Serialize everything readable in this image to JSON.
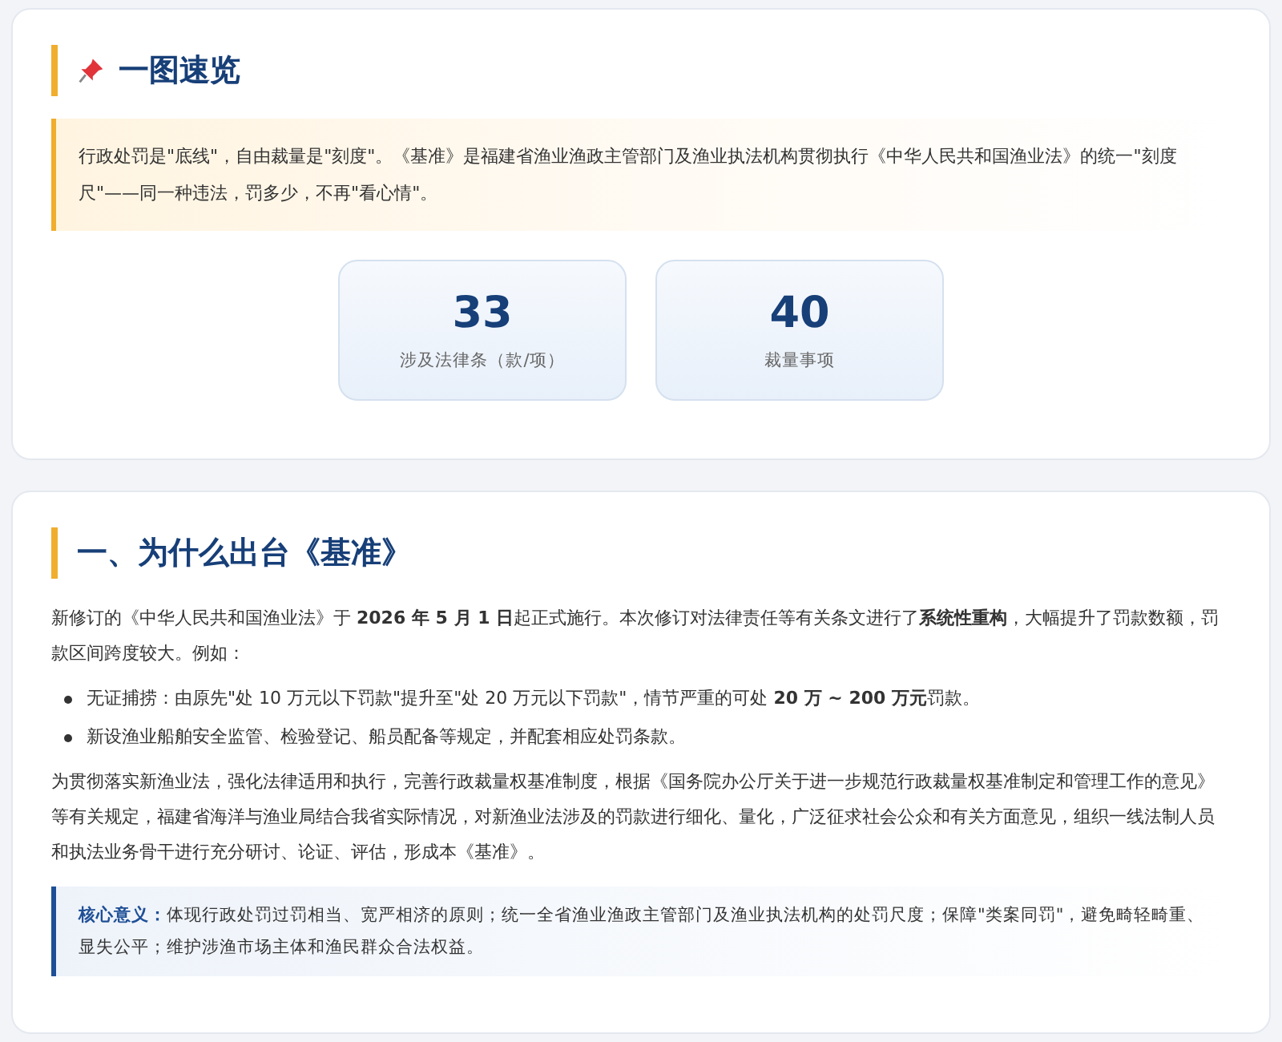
{
  "overview": {
    "title": "一图速览",
    "intro": "行政处罚是\"底线\"，自由裁量是\"刻度\"。《基准》是福建省渔业渔政主管部门及渔业执法机构贯彻执行《中华人民共和国渔业法》的统一\"刻度尺\"——同一种违法，罚多少，不再\"看心情\"。",
    "stats": [
      {
        "value": "33",
        "label": "涉及法律条（款/项）"
      },
      {
        "value": "40",
        "label": "裁量事项"
      }
    ]
  },
  "why": {
    "title": "一、为什么出台《基准》",
    "paragraph_1": "新修订的《中华人民共和国渔业法》于 **2026 年 5 月 1 日**起正式施行。本次修订对法律责任等有关条文进行了**系统性重构**，大幅提升了罚款数额，罚款区间跨度较大。例如：",
    "bullets": [
      "无证捕捞：由原先\"处 10 万元以下罚款\"提升至\"处 20 万元以下罚款\"，情节严重的可处 **20 万 ~ 200 万元**罚款。",
      "新设渔业船舶安全监管、检验登记、船员配备等规定，并配套相应处罚条款。"
    ],
    "paragraph_2": "为贯彻落实新渔业法，强化法律适用和执行，完善行政裁量权基准制度，根据《国务院办公厅关于进一步规范行政裁量权基准制定和管理工作的意见》等有关规定，福建省海洋与渔业局结合我省实际情况，对新渔业法涉及的罚款进行细化、量化，广泛征求社会公众和有关方面意见，组织一线法制人员和执法业务骨干进行充分研讨、论证、评估，形成本《基准》。",
    "callout": "**核心意义：**体现行政处罚过罚相当、宽严相济的原则；统一全省渔业渔政主管部门及渔业执法机构的处罚尺度；保障\"类案同罚\"，避免畸轻畸重、显失公平；维护涉渔市场主体和渔民群众合法权益。"
  }
}
